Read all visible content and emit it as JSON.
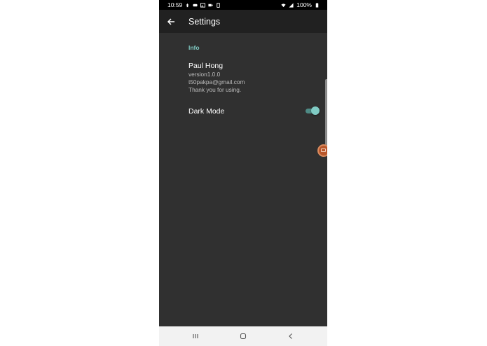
{
  "status_bar": {
    "time": "10:59",
    "battery": "100%",
    "icons": [
      "notification-icon",
      "game-icon",
      "image-icon",
      "video-icon",
      "sim-icon",
      "wifi-icon",
      "signal-icon",
      "battery-icon"
    ]
  },
  "app_bar": {
    "title": "Settings",
    "back_icon": "arrow-back-icon"
  },
  "sections": {
    "info_header": "Info"
  },
  "info": {
    "name": "Paul Hong",
    "version": "version1.0.0",
    "email": "t50pakpa@gmail.com",
    "thanks": "Thank you for using."
  },
  "dark_mode": {
    "label": "Dark Mode",
    "enabled": true
  },
  "colors": {
    "background": "#303030",
    "app_bar": "#212121",
    "accent": "#80cbc4",
    "bubble": "#b9572b"
  },
  "nav_bar": {
    "icons": [
      "recent-apps-icon",
      "home-icon",
      "back-icon"
    ]
  }
}
